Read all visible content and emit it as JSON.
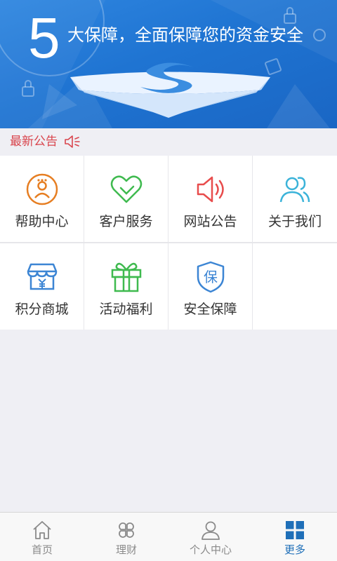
{
  "banner": {
    "number": "5",
    "title": "大保障，全面保障您的资金安全"
  },
  "notice": {
    "label": "最新公告",
    "icon": "speaker-icon"
  },
  "grid": {
    "items": [
      {
        "label": "帮助中心",
        "icon": "help-center-icon",
        "color": "#e67e22"
      },
      {
        "label": "客户服务",
        "icon": "heart-icon",
        "color": "#3fba4f"
      },
      {
        "label": "网站公告",
        "icon": "speaker-icon",
        "color": "#e84c4c"
      },
      {
        "label": "关于我们",
        "icon": "people-icon",
        "color": "#3bb3d9"
      },
      {
        "label": "积分商城",
        "icon": "shop-icon",
        "color": "#3c85d4"
      },
      {
        "label": "活动福利",
        "icon": "gift-icon",
        "color": "#3fba4f"
      },
      {
        "label": "安全保障",
        "icon": "shield-icon",
        "color": "#3c85d4",
        "glyph": "保"
      }
    ]
  },
  "tabbar": {
    "active_color": "#1f6fb8",
    "inactive_color": "#8a8a8a",
    "tabs": [
      {
        "label": "首页",
        "icon": "home-icon",
        "active": false
      },
      {
        "label": "理财",
        "icon": "petals-icon",
        "active": false
      },
      {
        "label": "个人中心",
        "icon": "user-icon",
        "active": false
      },
      {
        "label": "更多",
        "icon": "grid-icon",
        "active": true
      }
    ]
  }
}
